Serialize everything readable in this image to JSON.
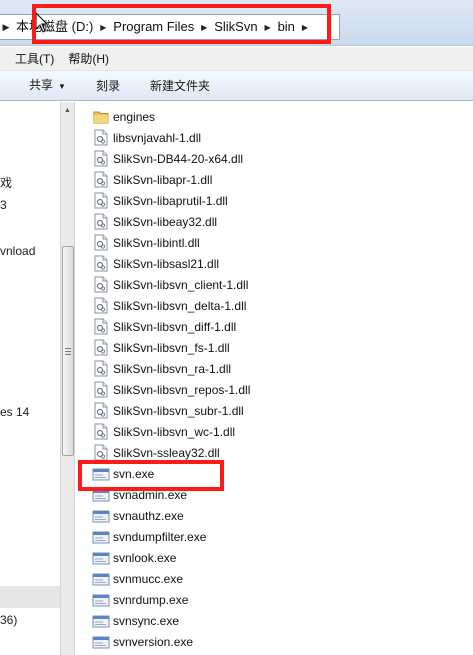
{
  "breadcrumb": {
    "items": [
      "本地磁盘 (D:)",
      "Program Files",
      "SlikSvn",
      "bin"
    ]
  },
  "menu": {
    "items": [
      "工具(T)",
      "帮助(H)"
    ]
  },
  "toolbar": {
    "share_label": "共享",
    "burn_label": "刻录",
    "new_folder_label": "新建文件夹"
  },
  "nav": {
    "items": [
      "戏",
      "3",
      "vnload",
      "es 14",
      "36)"
    ]
  },
  "files": [
    {
      "name": "engines",
      "icon": "folder-icon"
    },
    {
      "name": "libsvnjavahl-1.dll",
      "icon": "dll-icon"
    },
    {
      "name": "SlikSvn-DB44-20-x64.dll",
      "icon": "dll-icon"
    },
    {
      "name": "SlikSvn-libapr-1.dll",
      "icon": "dll-icon"
    },
    {
      "name": "SlikSvn-libaprutil-1.dll",
      "icon": "dll-icon"
    },
    {
      "name": "SlikSvn-libeay32.dll",
      "icon": "dll-icon"
    },
    {
      "name": "SlikSvn-libintl.dll",
      "icon": "dll-icon"
    },
    {
      "name": "SlikSvn-libsasl21.dll",
      "icon": "dll-icon"
    },
    {
      "name": "SlikSvn-libsvn_client-1.dll",
      "icon": "dll-icon"
    },
    {
      "name": "SlikSvn-libsvn_delta-1.dll",
      "icon": "dll-icon"
    },
    {
      "name": "SlikSvn-libsvn_diff-1.dll",
      "icon": "dll-icon"
    },
    {
      "name": "SlikSvn-libsvn_fs-1.dll",
      "icon": "dll-icon"
    },
    {
      "name": "SlikSvn-libsvn_ra-1.dll",
      "icon": "dll-icon"
    },
    {
      "name": "SlikSvn-libsvn_repos-1.dll",
      "icon": "dll-icon"
    },
    {
      "name": "SlikSvn-libsvn_subr-1.dll",
      "icon": "dll-icon"
    },
    {
      "name": "SlikSvn-libsvn_wc-1.dll",
      "icon": "dll-icon"
    },
    {
      "name": "SlikSvn-ssleay32.dll",
      "icon": "dll-icon"
    },
    {
      "name": "svn.exe",
      "icon": "exe-icon"
    },
    {
      "name": "svnadmin.exe",
      "icon": "exe-icon"
    },
    {
      "name": "svnauthz.exe",
      "icon": "exe-icon"
    },
    {
      "name": "svndumpfilter.exe",
      "icon": "exe-icon"
    },
    {
      "name": "svnlook.exe",
      "icon": "exe-icon"
    },
    {
      "name": "svnmucc.exe",
      "icon": "exe-icon"
    },
    {
      "name": "svnrdump.exe",
      "icon": "exe-icon"
    },
    {
      "name": "svnsync.exe",
      "icon": "exe-icon"
    },
    {
      "name": "svnversion.exe",
      "icon": "exe-icon"
    }
  ],
  "colors": {
    "highlight": "#ff1a1a",
    "toolbar_top": "#f6f9fd",
    "toolbar_bottom": "#dde8f5"
  }
}
